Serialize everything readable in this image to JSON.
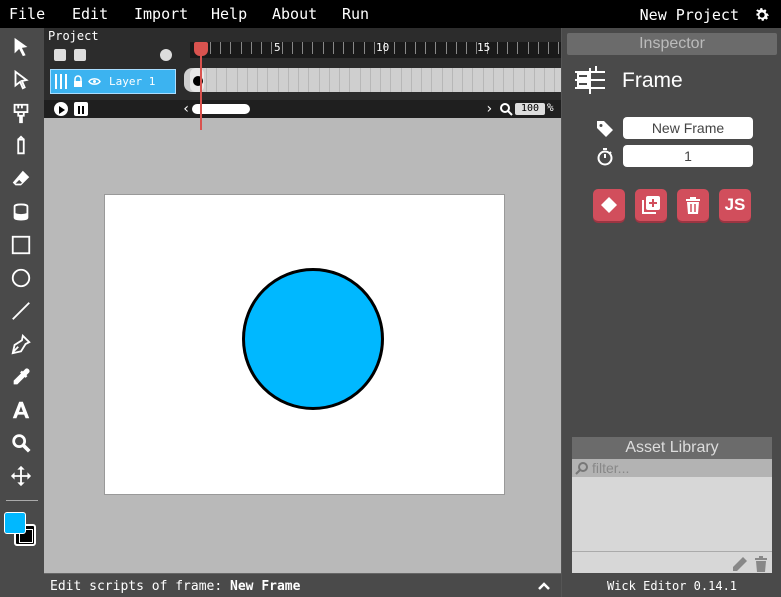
{
  "menubar": {
    "items": [
      "File",
      "Edit",
      "Import",
      "Help",
      "About",
      "Run"
    ],
    "project_name": "New Project"
  },
  "toolbar": {
    "tools": [
      "cursor-icon",
      "path-cursor-icon",
      "brush-icon",
      "pencil-icon",
      "eraser-icon",
      "fill-bucket-icon",
      "rectangle-icon",
      "ellipse-icon",
      "line-icon",
      "pen-icon",
      "eyedropper-icon",
      "text-icon",
      "zoom-icon",
      "pan-icon"
    ],
    "fill_color": "#00b8ff",
    "stroke_color": "#000000"
  },
  "timeline": {
    "project_label": "Project",
    "ruler_labels": [
      "5",
      "10",
      "15"
    ],
    "layer_label": "Layer 1",
    "zoom_value": "100",
    "zoom_unit": "%"
  },
  "canvas": {
    "circle_color": "#00b8ff"
  },
  "script_bar": {
    "prefix": "Edit scripts of frame: ",
    "frame_name": "New Frame"
  },
  "inspector": {
    "title": "Inspector",
    "selection_title": "Frame",
    "name_value": "New Frame",
    "length_value": "1",
    "js_label": "JS"
  },
  "asset_library": {
    "title": "Asset Library",
    "filter_placeholder": "filter..."
  },
  "footer": {
    "version": "Wick Editor 0.14.1"
  },
  "colors": {
    "accent_red": "#d14e5c",
    "layer_blue": "#3cb3f0"
  }
}
